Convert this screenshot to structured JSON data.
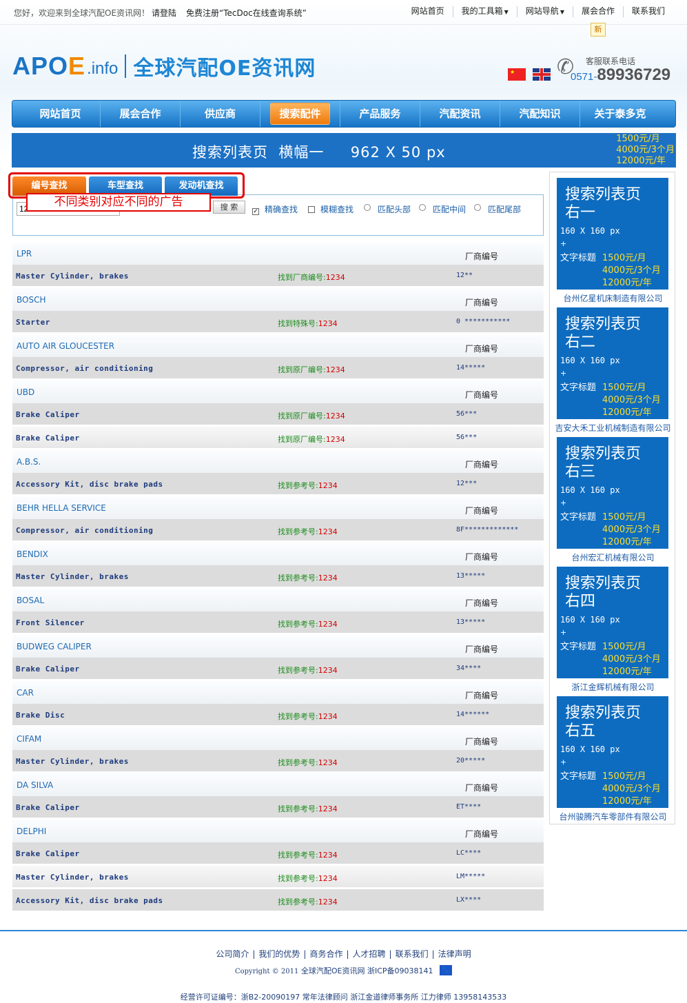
{
  "topbar": {
    "welcome": "您好，欢迎来到全球汽配OE资讯网！",
    "login": "请登陆",
    "register": "免费注册“TecDoc在线查询系统”",
    "nav": [
      {
        "label": "网站首页",
        "dropdown": false
      },
      {
        "label": "我的工具箱",
        "dropdown": true
      },
      {
        "label": "网站导航",
        "dropdown": true
      },
      {
        "label": "展会合作",
        "dropdown": false
      },
      {
        "label": "联系我们",
        "dropdown": false
      }
    ],
    "new_badge": "新"
  },
  "header": {
    "logo_text_a": "APO",
    "logo_text_b": "E",
    "logo_text_c": ".info",
    "site_name": "全球汽配OE资讯网",
    "service_label": "客服联系电话",
    "phone_prefix": "0571-",
    "phone_number": "89936729"
  },
  "mainnav": {
    "items": [
      "网站首页",
      "展会合作",
      "供应商",
      "搜索配件",
      "产品服务",
      "汽配资讯",
      "汽配知识",
      "关于泰多克"
    ],
    "active_index": 3
  },
  "banner": {
    "text": "搜索列表页  横幅一     962 X 50 px",
    "price1": "1500元/月",
    "price2": "4000元/3个月",
    "price3": "12000元/年"
  },
  "search": {
    "tabs": [
      "编号查找",
      "车型查找",
      "发动机查找"
    ],
    "active_tab": 0,
    "input_value": "1234",
    "button": "搜 索",
    "options": [
      {
        "label": "精确查找",
        "type": "checkbox",
        "checked": true
      },
      {
        "label": "模糊查找",
        "type": "checkbox",
        "checked": false
      },
      {
        "label": "匹配头部",
        "type": "radio",
        "checked": false
      },
      {
        "label": "匹配中间",
        "type": "radio",
        "checked": false
      },
      {
        "label": "匹配尾部",
        "type": "radio",
        "checked": false
      }
    ],
    "callout": "不同类别对应不同的广告"
  },
  "results": [
    {
      "brand": "LPR",
      "oe_label": "厂商编号",
      "items": [
        {
          "desc": "Master Cylinder, brakes",
          "found_label": "找到厂商编号:",
          "found_num": "1234",
          "code": "12**"
        }
      ]
    },
    {
      "brand": "BOSCH",
      "oe_label": "厂商编号",
      "items": [
        {
          "desc": "Starter",
          "found_label": "找到特殊号:",
          "found_num": "1234",
          "code": "0 ***********"
        }
      ]
    },
    {
      "brand": "AUTO AIR GLOUCESTER",
      "oe_label": "厂商编号",
      "items": [
        {
          "desc": "Compressor, air conditioning",
          "found_label": "找到原厂编号:",
          "found_num": "1234",
          "code": "14*****"
        }
      ]
    },
    {
      "brand": "UBD",
      "oe_label": "厂商编号",
      "items": [
        {
          "desc": "Brake Caliper",
          "found_label": "找到原厂编号:",
          "found_num": "1234",
          "code": "56***"
        },
        {
          "desc": "Brake Caliper",
          "found_label": "找到原厂编号:",
          "found_num": "1234",
          "code": "56***"
        }
      ]
    },
    {
      "brand": "A.B.S.",
      "oe_label": "厂商编号",
      "items": [
        {
          "desc": "Accessory Kit, disc brake pads",
          "found_label": "找到参考号:",
          "found_num": "1234",
          "code": "12***"
        }
      ]
    },
    {
      "brand": "BEHR HELLA SERVICE",
      "oe_label": "厂商编号",
      "items": [
        {
          "desc": "Compressor, air conditioning",
          "found_label": "找到参考号:",
          "found_num": "1234",
          "code": "8F*************"
        }
      ]
    },
    {
      "brand": "BENDIX",
      "oe_label": "厂商编号",
      "items": [
        {
          "desc": "Master Cylinder, brakes",
          "found_label": "找到参考号:",
          "found_num": "1234",
          "code": "13*****"
        }
      ]
    },
    {
      "brand": "BOSAL",
      "oe_label": "厂商编号",
      "items": [
        {
          "desc": "Front Silencer",
          "found_label": "找到参考号:",
          "found_num": "1234",
          "code": "13*****"
        }
      ]
    },
    {
      "brand": "BUDWEG CALIPER",
      "oe_label": "厂商编号",
      "items": [
        {
          "desc": "Brake Caliper",
          "found_label": "找到参考号:",
          "found_num": "1234",
          "code": "34****"
        }
      ]
    },
    {
      "brand": "CAR",
      "oe_label": "厂商编号",
      "items": [
        {
          "desc": "Brake Disc",
          "found_label": "找到参考号:",
          "found_num": "1234",
          "code": "14******"
        }
      ]
    },
    {
      "brand": "CIFAM",
      "oe_label": "厂商编号",
      "items": [
        {
          "desc": "Master Cylinder, brakes",
          "found_label": "找到参考号:",
          "found_num": "1234",
          "code": "20*****"
        }
      ]
    },
    {
      "brand": "DA SILVA",
      "oe_label": "厂商编号",
      "items": [
        {
          "desc": "Brake Caliper",
          "found_label": "找到参考号:",
          "found_num": "1234",
          "code": "ET****"
        }
      ]
    },
    {
      "brand": "DELPHI",
      "oe_label": "厂商编号",
      "items": [
        {
          "desc": "Brake Caliper",
          "found_label": "找到参考号:",
          "found_num": "1234",
          "code": "LC****"
        },
        {
          "desc": "Master Cylinder, brakes",
          "found_label": "找到参考号:",
          "found_num": "1234",
          "code": "LM*****"
        },
        {
          "desc": "Accessory Kit, disc brake pads",
          "found_label": "找到参考号:",
          "found_num": "1234",
          "code": "LX****"
        }
      ]
    }
  ],
  "side_ads": [
    {
      "title_a": "搜索列表页",
      "title_b": "右一",
      "size": "160 X 160 px",
      "plus": "+",
      "title_label": "文字标题",
      "p1": "1500元/月",
      "p2": "4000元/3个月",
      "p3": "12000元/年",
      "company": "台州亿星机床制造有限公司"
    },
    {
      "title_a": "搜索列表页",
      "title_b": "右二",
      "size": "160 X 160 px",
      "plus": "+",
      "title_label": "文字标题",
      "p1": "1500元/月",
      "p2": "4000元/3个月",
      "p3": "12000元/年",
      "company": "吉安大禾工业机械制造有限公司"
    },
    {
      "title_a": "搜索列表页",
      "title_b": "右三",
      "size": "160 X 160 px",
      "plus": "+",
      "title_label": "文字标题",
      "p1": "1500元/月",
      "p2": "4000元/3个月",
      "p3": "12000元/年",
      "company": "台州宏汇机械有限公司"
    },
    {
      "title_a": "搜索列表页",
      "title_b": "右四",
      "size": "160 X 160 px",
      "plus": "+",
      "title_label": "文字标题",
      "p1": "1500元/月",
      "p2": "4000元/3个月",
      "p3": "12000元/年",
      "company": "浙江金辉机械有限公司"
    },
    {
      "title_a": "搜索列表页",
      "title_b": "右五",
      "size": "160 X 160 px",
      "plus": "+",
      "title_label": "文字标题",
      "p1": "1500元/月",
      "p2": "4000元/3个月",
      "p3": "12000元/年",
      "company": "台州骏腾汽车零部件有限公司"
    }
  ],
  "footer": {
    "links": [
      "公司简介",
      "我们的优势",
      "商务合作",
      "人才招聘",
      "联系我们",
      "法律声明"
    ],
    "copyright_en": "Copyright © 2011",
    "copyright_cn": "全球汽配OE资讯网 浙ICP备09038141",
    "baidu_icon": "paw-icon",
    "license": "经营许可证编号：浙B2-20090197 常年法律顾问 浙江金道律师事务所 江力律师 13958143533"
  },
  "colors": {
    "brand_blue": "#1b74c6",
    "accent_orange": "#ee7a0d",
    "ad_blue": "#0d6cc0",
    "price_yellow": "#ffdf2a",
    "highlight_red": "#e40000",
    "found_green": "#1b8d1b"
  }
}
